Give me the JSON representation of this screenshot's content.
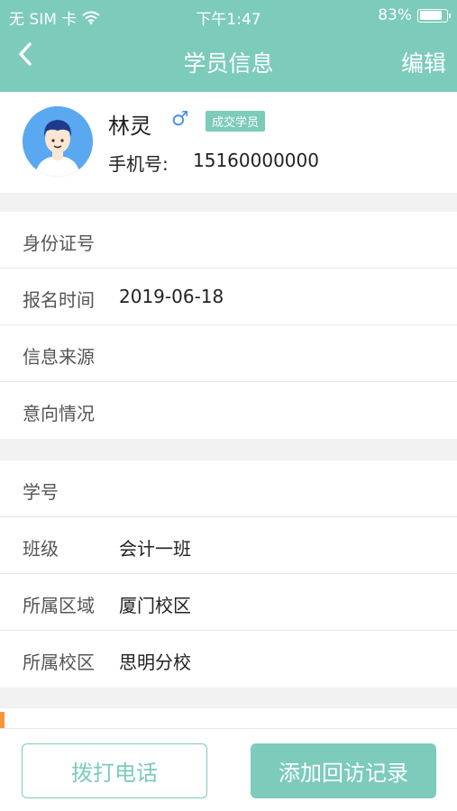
{
  "status_bar": {
    "carrier": "无 SIM 卡",
    "wifi_icon": "wifi-icon",
    "time": "下午1:47",
    "battery_percent": "83%",
    "battery_level": 0.83
  },
  "nav": {
    "back_icon": "chevron-left-icon",
    "title": "学员信息",
    "edit_label": "编辑"
  },
  "profile": {
    "avatar_icon": "user-avatar-icon",
    "name": "林灵",
    "gender_symbol": "♂",
    "badge": "成交学员",
    "phone_label": "手机号:",
    "phone": "15160000000"
  },
  "section1": [
    {
      "label": "身份证号",
      "value": ""
    },
    {
      "label": "报名时间",
      "value": "2019-06-18"
    },
    {
      "label": "信息来源",
      "value": ""
    },
    {
      "label": "意向情况",
      "value": ""
    }
  ],
  "section2": [
    {
      "label": "学号",
      "value": ""
    },
    {
      "label": "班级",
      "value": "会计一班"
    },
    {
      "label": "所属区域",
      "value": "厦门校区"
    },
    {
      "label": "所属校区",
      "value": "思明分校"
    }
  ],
  "actions": {
    "call_label": "拨打电话",
    "add_visit_label": "添加回访记录"
  },
  "colors": {
    "primary": "#7ccbbb",
    "accent": "#f5953b",
    "male_blue": "#4a90e2"
  }
}
